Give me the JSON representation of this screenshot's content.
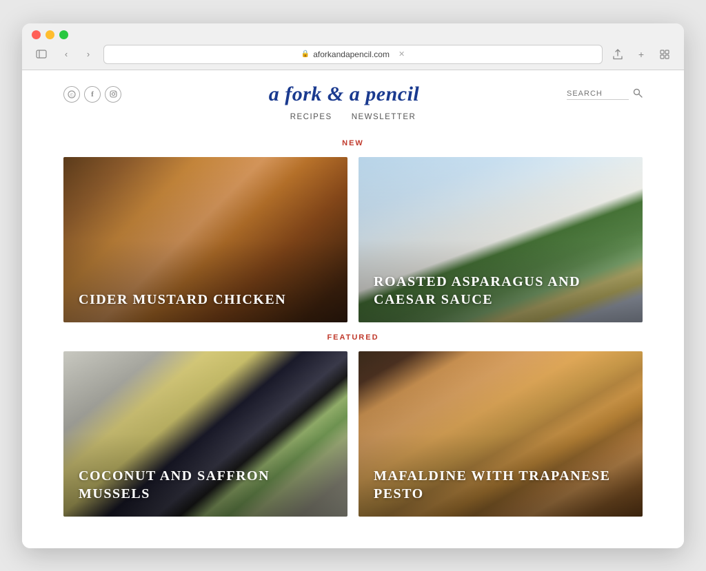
{
  "browser": {
    "url": "aforkandapencil.com",
    "nav": {
      "back": "‹",
      "forward": "›"
    }
  },
  "site": {
    "title": "a fork & a pencil",
    "social_icons": [
      "©",
      "f",
      "©"
    ],
    "search_placeholder": "SEARCH",
    "nav_items": [
      "RECIPES",
      "NEWSLETTER"
    ],
    "sections": {
      "new_label": "NEW",
      "featured_label": "FEATURED"
    },
    "new_recipes": [
      {
        "title": "CIDER MUSTARD CHICKEN",
        "img_class": "img-cider-chicken"
      },
      {
        "title": "ROASTED ASPARAGUS AND CAESAR SAUCE",
        "img_class": "img-asparagus"
      }
    ],
    "featured_recipes": [
      {
        "title": "COCONUT AND SAFFRON MUSSELS",
        "img_class": "img-mussels"
      },
      {
        "title": "MAFALDINE WITH TRAPANESE PESTO",
        "img_class": "img-mafaldine"
      }
    ]
  }
}
